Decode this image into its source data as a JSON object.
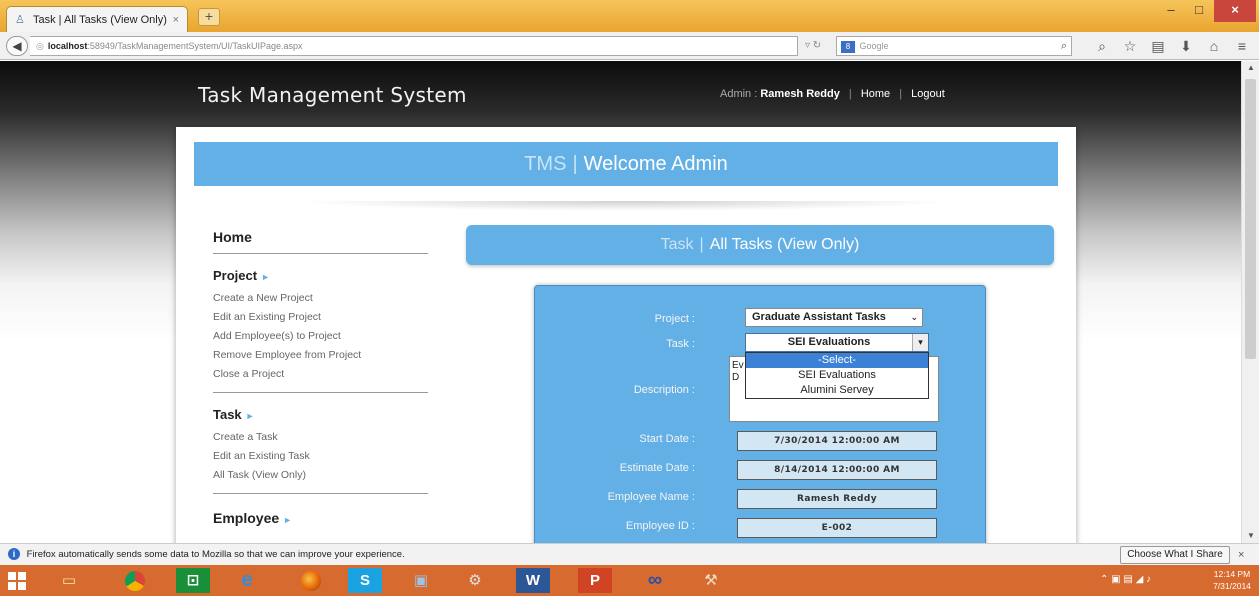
{
  "browser": {
    "tab_title": "Task | All Tasks (View Only)",
    "tab_close": "×",
    "new_tab": "+",
    "url_host": "localhost",
    "url_rest": ":58949/TaskManagementSystem/UI/TaskUIPage.aspx",
    "search_placeholder": "Google",
    "search_engine_badge": "8",
    "window": {
      "minimize": "–",
      "maximize": "□",
      "close": "×"
    }
  },
  "header": {
    "logo": "Task Management System",
    "role_label": "Admin :",
    "user_name": "Ramesh Reddy",
    "home": "Home",
    "logout": "Logout"
  },
  "banner": {
    "prefix": "TMS",
    "separator": "|",
    "title": "Welcome Admin"
  },
  "sidebar": {
    "home": "Home",
    "project_heading": "Project",
    "project_links": [
      "Create a New Project",
      "Edit an Existing Project",
      "Add Employee(s) to Project",
      "Remove Employee from Project",
      "Close a Project"
    ],
    "task_heading": "Task",
    "task_links": [
      "Create a Task",
      "Edit an Existing Task",
      "All Task (View Only)"
    ],
    "employee_heading": "Employee",
    "arrow": "►"
  },
  "task_header": {
    "prefix": "Task",
    "separator": "|",
    "title": "All Tasks (View Only)"
  },
  "form": {
    "project_label": "Project :",
    "project_value": "Graduate Assistant Tasks",
    "task_label": "Task :",
    "task_value": "SEI Evaluations",
    "description_label": "Description :",
    "description_peek": [
      "Ev",
      "D"
    ],
    "task_options": [
      "-Select-",
      "SEI Evaluations",
      "Alumini Servey"
    ],
    "start_date_label": "Start Date :",
    "start_date": "7/30/2014 12:00:00 AM",
    "estimate_date_label": "Estimate Date :",
    "estimate_date": "8/14/2014 12:00:00 AM",
    "employee_name_label": "Employee Name :",
    "employee_name": "Ramesh Reddy",
    "employee_id_label": "Employee ID :",
    "employee_id": "E-002"
  },
  "notification": {
    "text": "Firefox automatically sends some data to Mozilla so that we can improve your experience.",
    "button": "Choose What I Share",
    "close": "×"
  },
  "taskbar": {
    "apps": [
      "explorer",
      "chrome",
      "store",
      "internet-explorer",
      "firefox",
      "skype",
      "remote-desktop",
      "tools",
      "word",
      "powerpoint",
      "infinity",
      "setup"
    ],
    "time": "12:14 PM",
    "date": "7/31/2014"
  },
  "colors": {
    "accent_blue": "#63b0e6",
    "taskbar": "#d76a2e",
    "browser_tab_strip": "#f0b340"
  }
}
